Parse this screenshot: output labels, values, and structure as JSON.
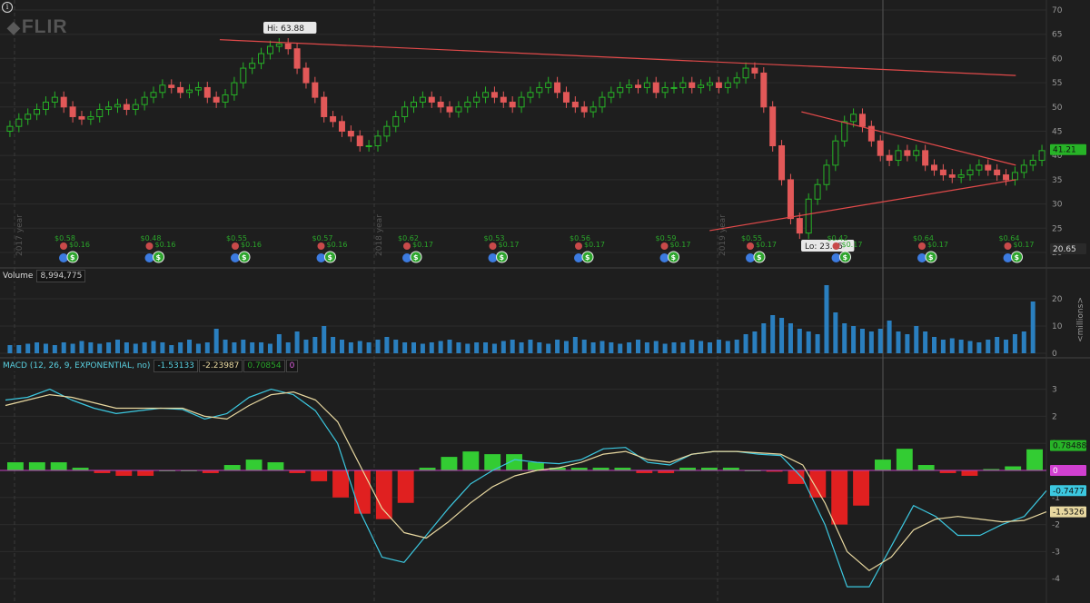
{
  "app": {
    "logo_text": "FLIR"
  },
  "price": {
    "hi_label": "Hi: 63.88",
    "lo_label": "Lo: 23.85",
    "last_badge": "41.21",
    "level_badge": "20.65",
    "axis": [
      70,
      65,
      60,
      55,
      50,
      45,
      40,
      35,
      30,
      25,
      20
    ],
    "year_labels": [
      "2017 year",
      "2018 year",
      "2019 year"
    ]
  },
  "volume": {
    "title": "Volume",
    "value": "8,994,775",
    "axis": [
      20,
      10,
      0
    ],
    "unit_label": "<millions>"
  },
  "macd": {
    "title": "MACD (12, 26, 9, EXPONENTIAL, no)",
    "v1": "-1.53133",
    "v2": "-2.23987",
    "v3": "0.70854",
    "v4": "0",
    "axis": [
      3,
      2,
      1,
      0,
      -1,
      -2,
      -3,
      -4
    ],
    "badges": {
      "hist": "0.78488",
      "zero": "0",
      "macd": "-0.7477",
      "signal": "-1.5326"
    }
  },
  "events": {
    "dividends": [
      "$0.58",
      "$0.48",
      "$0.55",
      "$0.57",
      "$0.62",
      "$0.53",
      "$0.56",
      "$0.59",
      "$0.55",
      "$0.42",
      "$0.64",
      "$0.64"
    ],
    "eps": [
      "$0.16",
      "$0.16",
      "$0.16",
      "$0.16",
      "$0.17",
      "$0.17",
      "$0.17",
      "$0.17",
      "$0.17",
      "$0.17",
      "$0.17",
      "$0.17"
    ]
  },
  "chart_data": {
    "type": "candlestick",
    "ticker": "FLIR",
    "x_start": "2017-01",
    "x_end": "2019-10",
    "price_range": [
      20,
      70
    ],
    "close": [
      46,
      47.5,
      48.5,
      49.5,
      51,
      52,
      50,
      48,
      47.5,
      48,
      49.5,
      50,
      50.5,
      49.5,
      50.5,
      52,
      53,
      54.5,
      54,
      53,
      53.5,
      54,
      52,
      51,
      52.5,
      55,
      58,
      59,
      61,
      62.5,
      63,
      62,
      58,
      55,
      52,
      48,
      47,
      45,
      44,
      42,
      42,
      44,
      46,
      48,
      50,
      51,
      52,
      51,
      50,
      49,
      50,
      51,
      52,
      53,
      52,
      51,
      50,
      52,
      53,
      54,
      55,
      53,
      51,
      50,
      49,
      50,
      52,
      53,
      54,
      54.5,
      54,
      55,
      53,
      54,
      54,
      55,
      54,
      54.5,
      55,
      54,
      55,
      56,
      58,
      57,
      50,
      42,
      35,
      27,
      24,
      31,
      34,
      38,
      43,
      47,
      48.5,
      46,
      43,
      40,
      39,
      41,
      40,
      41,
      38,
      37,
      36,
      35.5,
      36,
      37,
      38,
      37,
      36,
      35,
      36.5,
      38,
      39,
      41
    ],
    "volume_millions": [
      3,
      3,
      3.5,
      4,
      3.5,
      3,
      4,
      3.5,
      4.5,
      4,
      3.5,
      4,
      5,
      4,
      3.5,
      4,
      4.5,
      4,
      3,
      4,
      5,
      3.5,
      4,
      9,
      5,
      4,
      5,
      4,
      4,
      3.5,
      7,
      4,
      8,
      5,
      6,
      10,
      6,
      5,
      4,
      4.5,
      4,
      5,
      6,
      5,
      4,
      4,
      3.5,
      4,
      4.5,
      5,
      4,
      3.5,
      4,
      4,
      3.5,
      4.5,
      5,
      4,
      5,
      4,
      3.5,
      5,
      4.5,
      6,
      5,
      4,
      4.5,
      4,
      3.5,
      4,
      5,
      4,
      4.5,
      3.5,
      4,
      4,
      5,
      4.5,
      4,
      5,
      4.5,
      5,
      7,
      8,
      11,
      14,
      13,
      11,
      9,
      8,
      7,
      25,
      15,
      11,
      10,
      9,
      8,
      9,
      12,
      8,
      7,
      10,
      8,
      6,
      5,
      5.5,
      5,
      4.5,
      4,
      5,
      6,
      5,
      7,
      8,
      19
    ],
    "macd": [
      2.6,
      2.7,
      3.0,
      2.6,
      2.3,
      2.1,
      2.2,
      2.3,
      2.25,
      1.9,
      2.1,
      2.7,
      3.0,
      2.8,
      2.2,
      1.0,
      -1.5,
      -3.2,
      -3.4,
      -2.4,
      -1.4,
      -0.5,
      0.0,
      0.4,
      0.3,
      0.25,
      0.4,
      0.8,
      0.85,
      0.3,
      0.2,
      0.6,
      0.7,
      0.7,
      0.6,
      0.55,
      -0.3,
      -2.0,
      -4.3,
      -4.3,
      -2.8,
      -1.3,
      -1.7,
      -2.4,
      -2.4,
      -2.0,
      -1.7,
      -0.75
    ],
    "signal": [
      2.4,
      2.6,
      2.8,
      2.7,
      2.5,
      2.3,
      2.3,
      2.3,
      2.3,
      2.0,
      1.9,
      2.4,
      2.8,
      2.9,
      2.6,
      1.8,
      0.2,
      -1.4,
      -2.3,
      -2.5,
      -1.9,
      -1.2,
      -0.6,
      -0.2,
      0.0,
      0.1,
      0.3,
      0.6,
      0.7,
      0.4,
      0.3,
      0.6,
      0.7,
      0.7,
      0.65,
      0.6,
      0.2,
      -1.2,
      -3.0,
      -3.7,
      -3.2,
      -2.2,
      -1.8,
      -1.7,
      -1.8,
      -1.9,
      -1.85,
      -1.53
    ],
    "histogram": [
      0.3,
      0.3,
      0.3,
      0.1,
      -0.1,
      -0.2,
      -0.2,
      0,
      0,
      -0.1,
      0.2,
      0.4,
      0.3,
      -0.1,
      -0.4,
      -1.0,
      -1.6,
      -1.8,
      -1.2,
      0.1,
      0.5,
      0.7,
      0.6,
      0.6,
      0.3,
      0.1,
      0.1,
      0.1,
      0.1,
      -0.1,
      -0.1,
      0.1,
      0.1,
      0.1,
      0,
      -0.05,
      -0.5,
      -1.0,
      -2.0,
      -1.3,
      0.4,
      0.8,
      0.2,
      -0.1,
      -0.2,
      0.05,
      0.15,
      0.78
    ],
    "trendlines": [
      {
        "from": [
          "2017-08",
          63.88
        ],
        "to": [
          "2019-10",
          56.5
        ]
      },
      {
        "from": [
          "2019-03",
          49
        ],
        "to": [
          "2019-10",
          38
        ]
      },
      {
        "from": [
          "2018-12",
          24.5
        ],
        "to": [
          "2019-10",
          35
        ]
      }
    ],
    "legend": "none"
  }
}
